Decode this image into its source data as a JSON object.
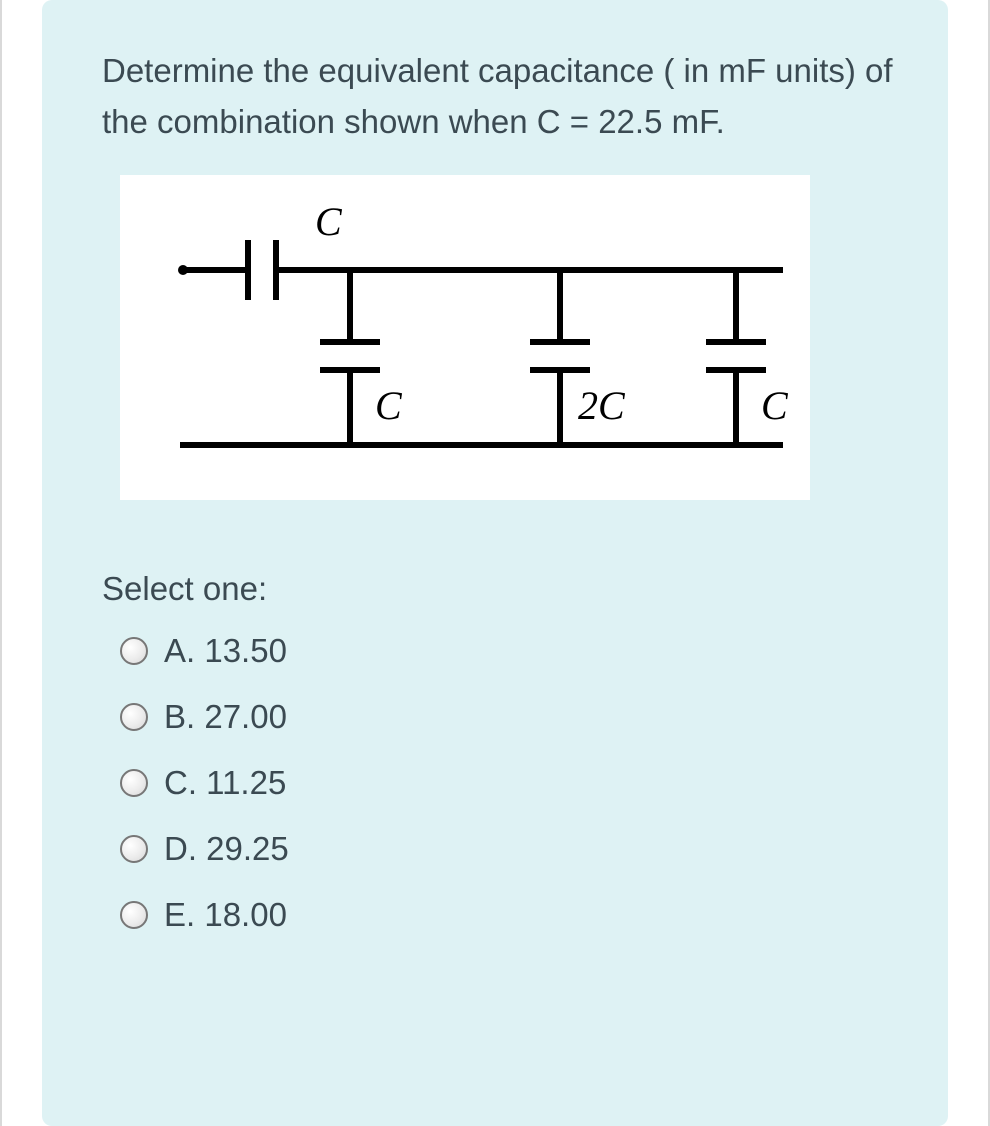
{
  "question": "Determine the equivalent capacitance ( in mF units) of the combination shown when C = 22.5 mF.",
  "diagram": {
    "labels": {
      "top": "C",
      "left": "C",
      "middle": "2C",
      "right": "C"
    }
  },
  "select_prompt": "Select one:",
  "options": [
    {
      "key": "A",
      "text": "A. 13.50"
    },
    {
      "key": "B",
      "text": "B. 27.00"
    },
    {
      "key": "C",
      "text": "C. 11.25"
    },
    {
      "key": "D",
      "text": "D. 29.25"
    },
    {
      "key": "E",
      "text": "E. 18.00"
    }
  ]
}
